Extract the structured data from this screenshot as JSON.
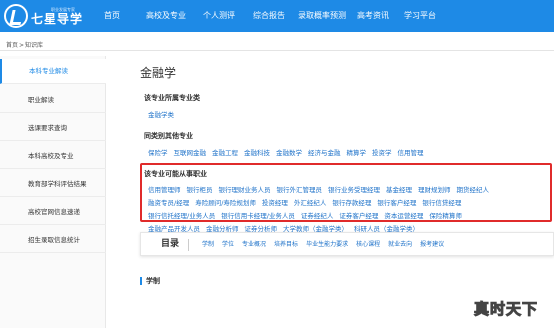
{
  "header": {
    "logo_slogan": "职业发展专家",
    "logo_name": "七星导学",
    "nav": [
      "首页",
      "高校及专业",
      "个人测评",
      "综合报告",
      "录取概率预测",
      "高考资讯",
      "学习平台"
    ]
  },
  "breadcrumb": [
    "首页",
    ">",
    "知识库"
  ],
  "sidebar": {
    "items": [
      "本科专业解读",
      "职业解读",
      "选课要求查询",
      "本科高校及专业",
      "教育部学科评估结果",
      "高校官网信息速递",
      "招生录取信息统计"
    ]
  },
  "main": {
    "title": "金融学",
    "sections": [
      {
        "label": "该专业所属专业类",
        "tags": [
          "金融学类"
        ]
      },
      {
        "label": "同类别其他专业",
        "tags": [
          "保险学",
          "互联网金融",
          "金融工程",
          "金融科技",
          "金融数学",
          "经济与金融",
          "精算学",
          "投资学",
          "信用管理"
        ]
      },
      {
        "label": "该专业可能从事职业",
        "rows": [
          [
            "信用管理师",
            "银行柜员",
            "银行理财业务人员",
            "银行外汇管理员",
            "银行业务受理经理",
            "基金经理",
            "理财规划师",
            "期货经纪人"
          ],
          [
            "融资专员/经理",
            "寿险顾问/寿险规划师",
            "投资经理",
            "外汇经纪人",
            "银行存款经理",
            "银行客户经理",
            "银行信贷经理"
          ],
          [
            "银行信托经理/业务人员",
            "银行信用卡经理/业务人员",
            "证券经纪人",
            "证券客户经理",
            "资本运营经理",
            "保险精算师"
          ],
          [
            "金融产品开发人员",
            "金融分析师",
            "证券分析师",
            "大学教师（金融学类）",
            "科研人员（金融学类）"
          ]
        ]
      }
    ]
  },
  "directory": {
    "title": "目录",
    "links": [
      "学制",
      "学位",
      "专业概况",
      "培养目标",
      "毕业生能力要求",
      "核心课程",
      "就业去向",
      "报考建议"
    ]
  },
  "system_label": "学制",
  "watermark": "真时天下",
  "colors": {
    "header_blue": "#1e8ae6",
    "link_blue": "#1e72c9",
    "highlight_red": "#e02b2b"
  }
}
